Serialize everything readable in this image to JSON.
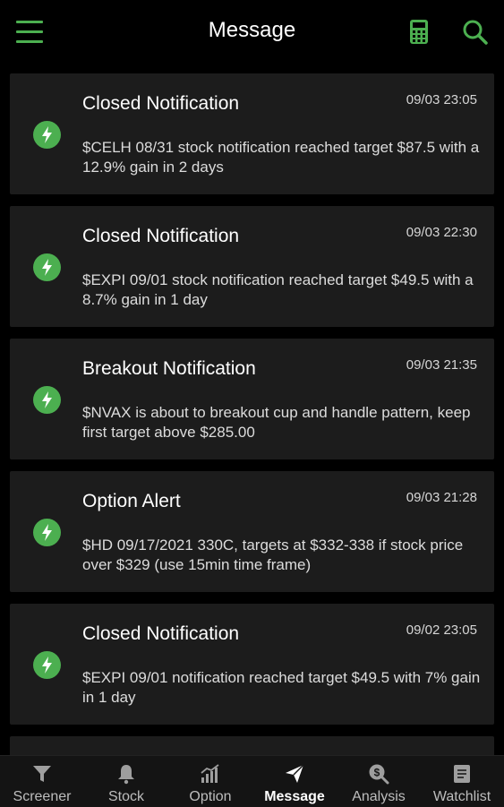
{
  "header": {
    "title": "Message",
    "menu_icon": "hamburger-menu-icon",
    "calculator_icon": "calculator-icon",
    "search_icon": "search-icon",
    "accent_color": "#4caf50"
  },
  "messages": [
    {
      "title": "Closed Notification",
      "time": "09/03 23:05",
      "body": "$CELH 08/31 stock notification reached target $87.5 with a 12.9% gain in 2 days",
      "icon": "lightning-bolt-icon"
    },
    {
      "title": "Closed Notification",
      "time": "09/03 22:30",
      "body": "$EXPI 09/01 stock notification reached target $49.5 with a 8.7% gain in 1 day",
      "icon": "lightning-bolt-icon"
    },
    {
      "title": "Breakout Notification",
      "time": "09/03 21:35",
      "body": "$NVAX is about to breakout cup and handle pattern, keep first target above $285.00",
      "icon": "lightning-bolt-icon"
    },
    {
      "title": "Option Alert",
      "time": "09/03 21:28",
      "body": "$HD 09/17/2021 330C, targets at $332-338 if stock price over $329 (use 15min time frame)",
      "icon": "lightning-bolt-icon"
    },
    {
      "title": "Closed Notification",
      "time": "09/02 23:05",
      "body": "$EXPI 09/01 notification reached target $49.5 with 7% gain in 1 day",
      "icon": "lightning-bolt-icon"
    }
  ],
  "bottom_nav": {
    "items": [
      {
        "label": "Screener",
        "icon": "filter-icon"
      },
      {
        "label": "Stock",
        "icon": "bell-icon"
      },
      {
        "label": "Option",
        "icon": "bar-chart-icon"
      },
      {
        "label": "Message",
        "icon": "paper-plane-icon",
        "active": true
      },
      {
        "label": "Analysis",
        "icon": "dollar-search-icon"
      },
      {
        "label": "Watchlist",
        "icon": "notebook-icon"
      }
    ]
  }
}
